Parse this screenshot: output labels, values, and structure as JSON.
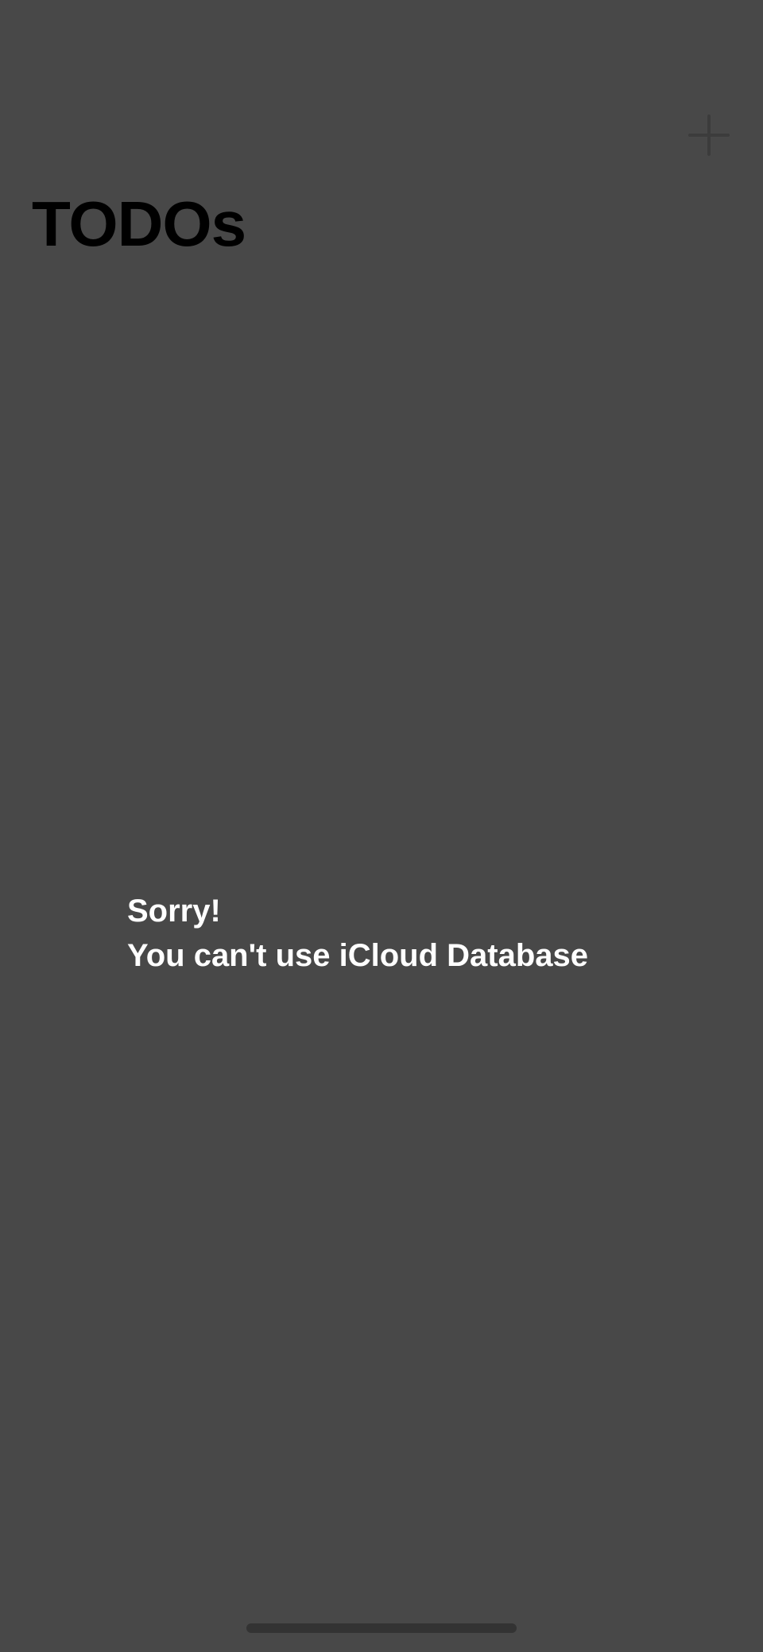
{
  "app": {
    "title": "TODOs",
    "add_icon": "plus-icon"
  },
  "empty_state": {
    "line1": "Sorry!",
    "line2": "You can't use iCloud Database"
  },
  "colors": {
    "background": "#484848",
    "title": "#000000",
    "message": "#ffffff",
    "add_icon": "#3c3c3c",
    "home_indicator": "#333333"
  }
}
